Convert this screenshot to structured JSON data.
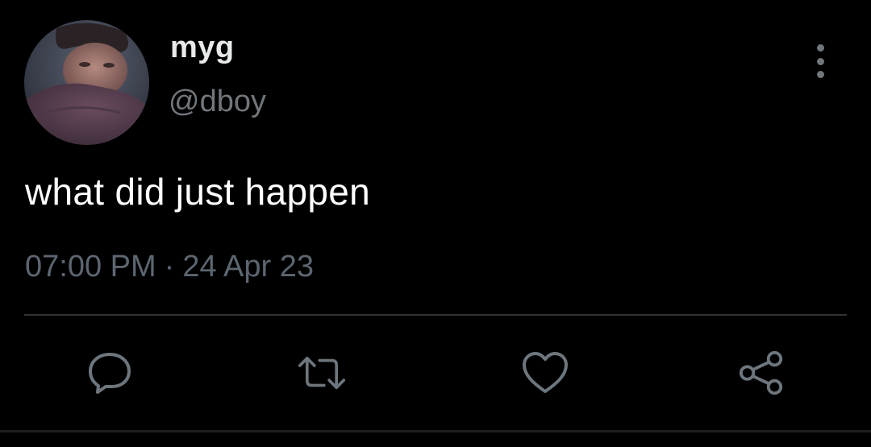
{
  "tweet": {
    "display_name": "myg",
    "handle": "@dboy",
    "text": "what did just happen",
    "time": "07:00 PM",
    "separator": "·",
    "date": "24 Apr 23"
  },
  "icons": {
    "more": "more-vertical-icon",
    "reply": "reply-icon",
    "retweet": "retweet-icon",
    "like": "heart-icon",
    "share": "share-icon"
  },
  "colors": {
    "background": "#000000",
    "text_primary": "#ffffff",
    "text_secondary": "#71767b",
    "icon": "#6e767d",
    "divider": "#2f3336"
  }
}
